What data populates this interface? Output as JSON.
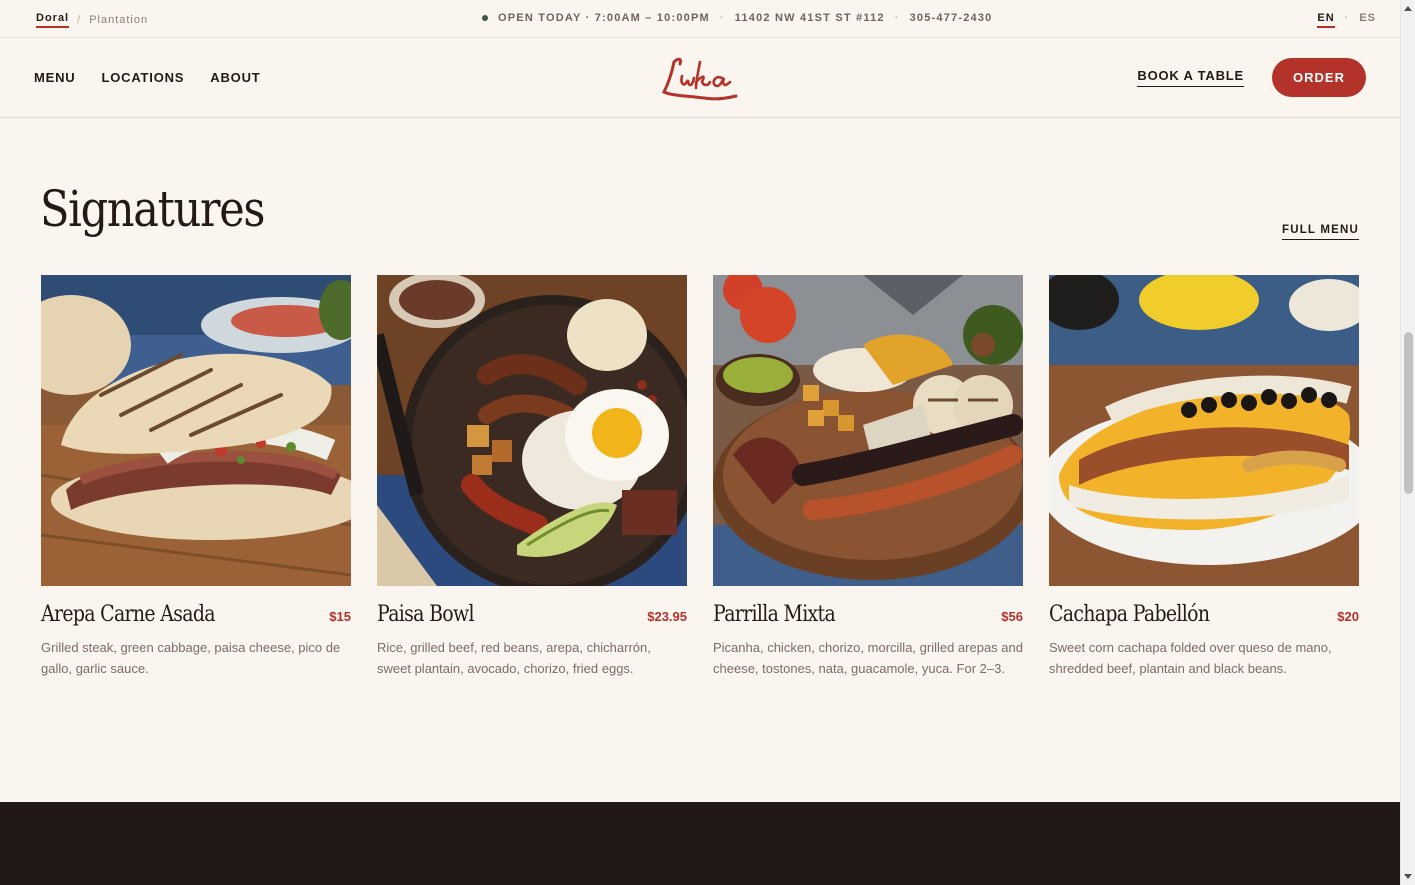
{
  "utility": {
    "locations": [
      "Doral",
      "Plantation"
    ],
    "status": "OPEN TODAY · 7:00AM – 10:00PM",
    "address": "11402 NW 41ST ST #112",
    "phone": "305-477-2430",
    "languages": [
      "EN",
      "ES"
    ]
  },
  "nav": {
    "links": [
      "MENU",
      "LOCATIONS",
      "ABOUT"
    ],
    "logo_text": "Luka",
    "book_label": "BOOK A TABLE",
    "order_label": "ORDER"
  },
  "section": {
    "title": "Signatures",
    "full_menu_label": "FULL MENU",
    "items": [
      {
        "name": "Arepa Carne Asada",
        "price": "$15",
        "description": "Grilled steak, green cabbage, paisa cheese, pico de gallo, garlic sauce."
      },
      {
        "name": "Paisa Bowl",
        "price": "$23.95",
        "description": "Rice, grilled beef, red beans, arepa, chicharrón, sweet plantain, avocado, chorizo, fried eggs."
      },
      {
        "name": "Parrilla Mixta",
        "price": "$56",
        "description": "Picanha, chicken, chorizo, morcilla, grilled arepas and cheese, tostones, nata, guacamole, yuca. For 2–3."
      },
      {
        "name": "Cachapa Pabellón",
        "price": "$20",
        "description": "Sweet corn cachapa folded over queso de mano, shredded beef, plantain and black beans."
      }
    ]
  },
  "colors": {
    "accent": "#b3322a",
    "background": "#faf5ef",
    "dark": "#221917"
  }
}
